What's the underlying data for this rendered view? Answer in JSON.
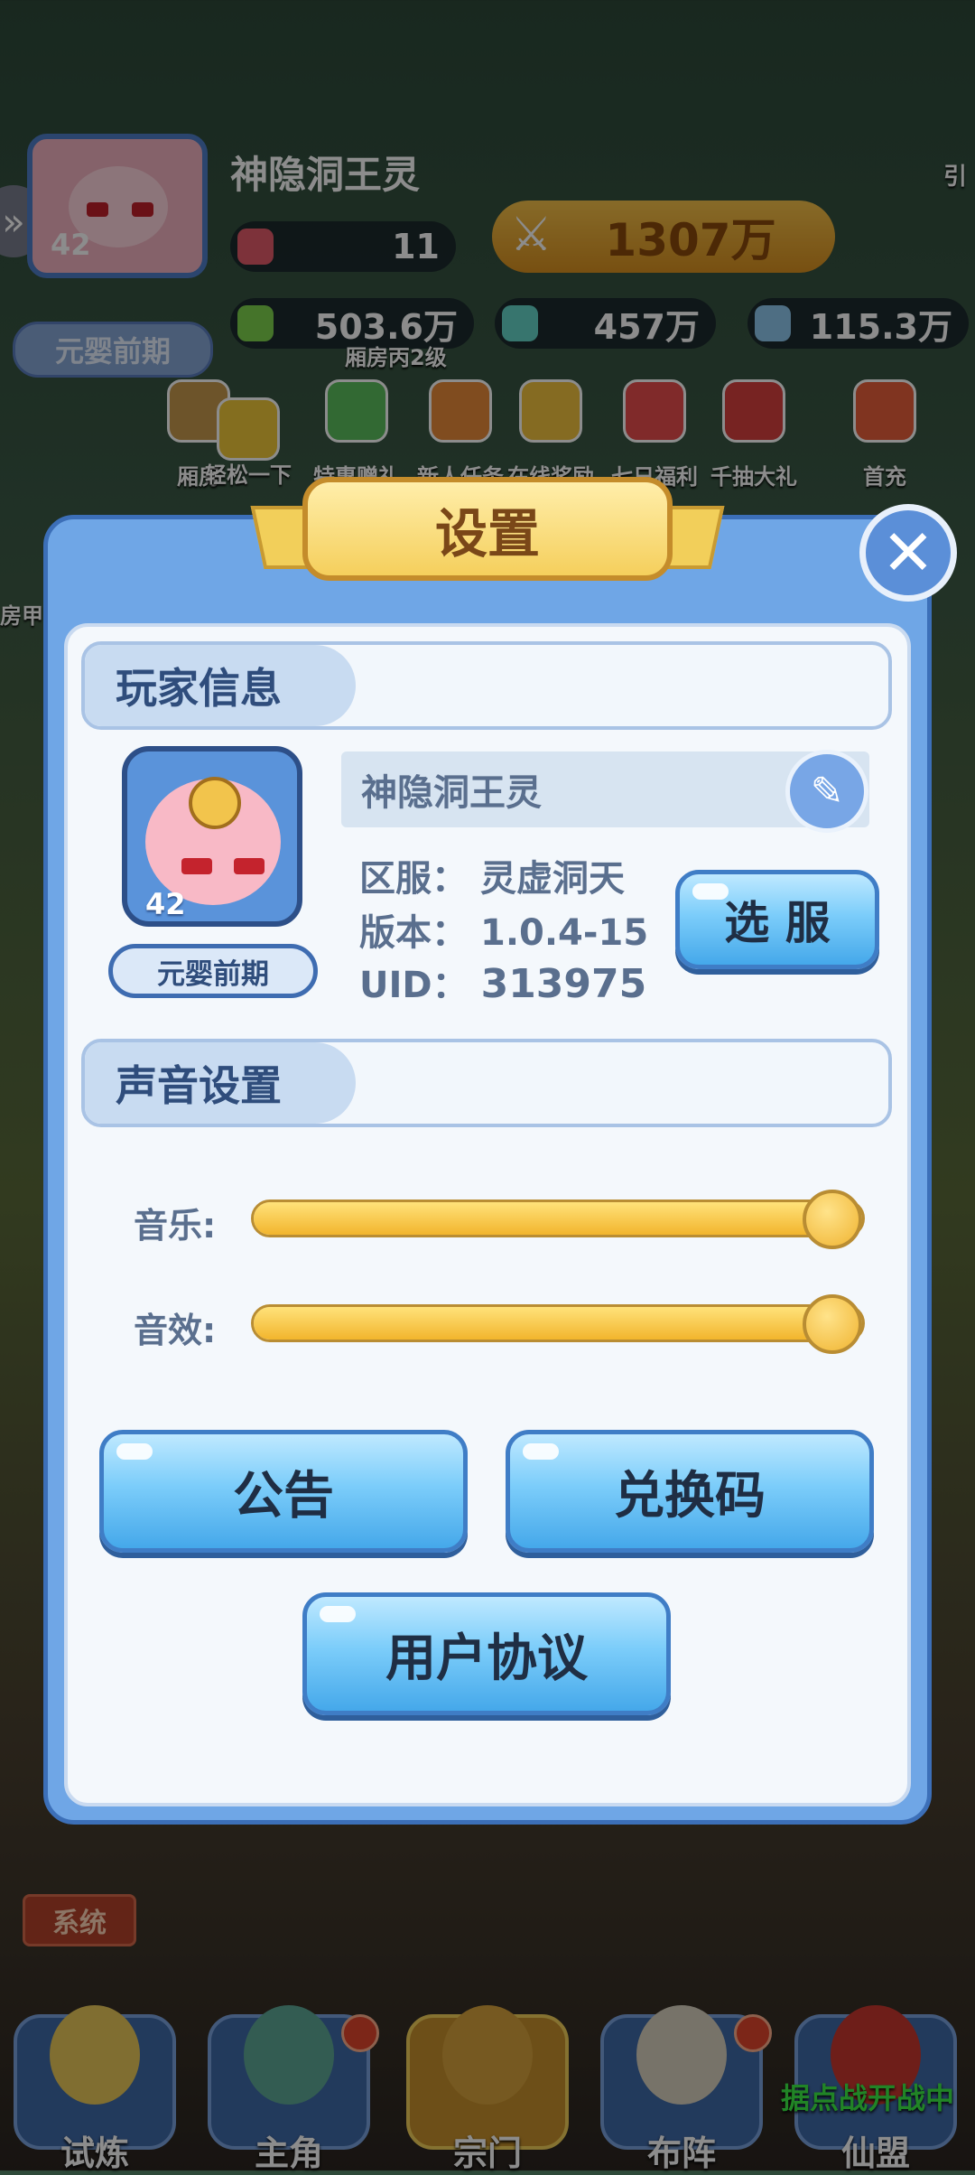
{
  "hud": {
    "player_name": "神隐洞王灵",
    "level": "42",
    "realm": "元婴前期",
    "stamina": "11",
    "power": "1307万",
    "res1": "503.6万",
    "res2": "457万",
    "res3": "115.3万",
    "room_level": "厢房丙2级",
    "right_edge_label": "引",
    "left_edge_label": "房甲",
    "menu": [
      "厢房",
      "轻松一下",
      "特惠赠礼",
      "新人任务",
      "在线奖励",
      "七日福利",
      "千抽大礼",
      "首充"
    ]
  },
  "dialog": {
    "title": "设置",
    "close_icon": "close-icon",
    "player_section": "玩家信息",
    "player_name": "神隐洞王灵",
    "player_level": "42",
    "player_realm": "元婴前期",
    "server_label": "区服：",
    "server_value": "灵虚洞天",
    "version_label": "版本：",
    "version_value": "1.0.4-15",
    "uid_label": "UID：",
    "uid_value": "313975",
    "select_server_button": "选 服",
    "sound_section": "声音设置",
    "music_label": "音乐:",
    "music_level": 1.0,
    "sfx_label": "音效:",
    "sfx_level": 1.0,
    "notice_button": "公告",
    "redeem_button": "兑换码",
    "agreement_button": "用户协议"
  },
  "bottom": {
    "system_tag": "系统",
    "nav": [
      "试炼",
      "主角",
      "宗门",
      "布阵",
      "仙盟"
    ],
    "ribbon": "据点战开战中"
  },
  "colors": {
    "dialog_frame": "#6fa6e6",
    "dialog_panel": "#f4f8fc",
    "title_gold": "#f5cf5c",
    "button_blue": "#7ccdfa",
    "slider_gold": "#f2b52d"
  }
}
